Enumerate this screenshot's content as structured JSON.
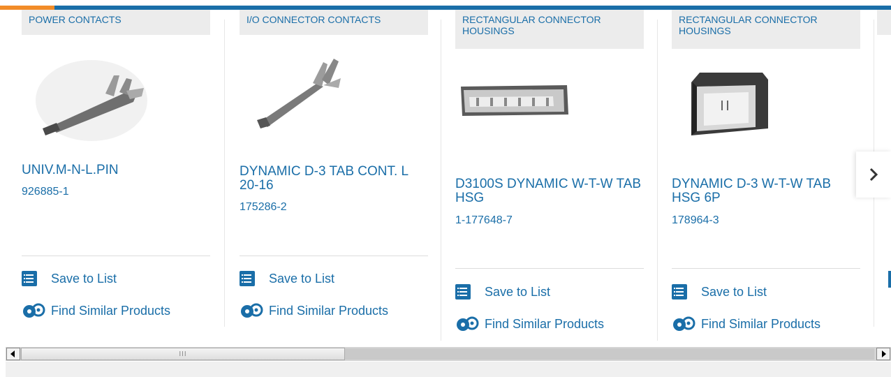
{
  "cards": [
    {
      "category": "POWER CONTACTS",
      "title": "UNIV.M-N-L.PIN",
      "part_number": "926885-1",
      "save_label": "Save to List",
      "similar_label": "Find Similar Products",
      "image": "power-contact-pin-image"
    },
    {
      "category": "I/O CONNECTOR CONTACTS",
      "title": "DYNAMIC D-3 TAB CONT. L 20-16",
      "part_number": "175286-2",
      "save_label": "Save to List",
      "similar_label": "Find Similar Products",
      "image": "tab-contact-image"
    },
    {
      "category": "RECTANGULAR CONNECTOR HOUSINGS",
      "title": "D3100S DYNAMIC W-T-W TAB HSG",
      "part_number": "1-177648-7",
      "save_label": "Save to List",
      "similar_label": "Find Similar Products",
      "image": "long-housing-image"
    },
    {
      "category": "RECTANGULAR CONNECTOR HOUSINGS",
      "title": "DYNAMIC D-3 W-T-W TAB HSG 6P",
      "part_number": "178964-3",
      "save_label": "Save to List",
      "similar_label": "Find Similar Products",
      "image": "square-housing-image"
    }
  ],
  "carousel": {
    "next_icon": "chevron-right-icon"
  },
  "scrollbar": {
    "left_icon": "arrow-left-icon",
    "right_icon": "arrow-right-icon",
    "thumb_grip": "III"
  },
  "colors": {
    "brand_blue": "#1a6ea8",
    "accent_orange": "#f28c28",
    "tag_bg": "#ececec"
  }
}
